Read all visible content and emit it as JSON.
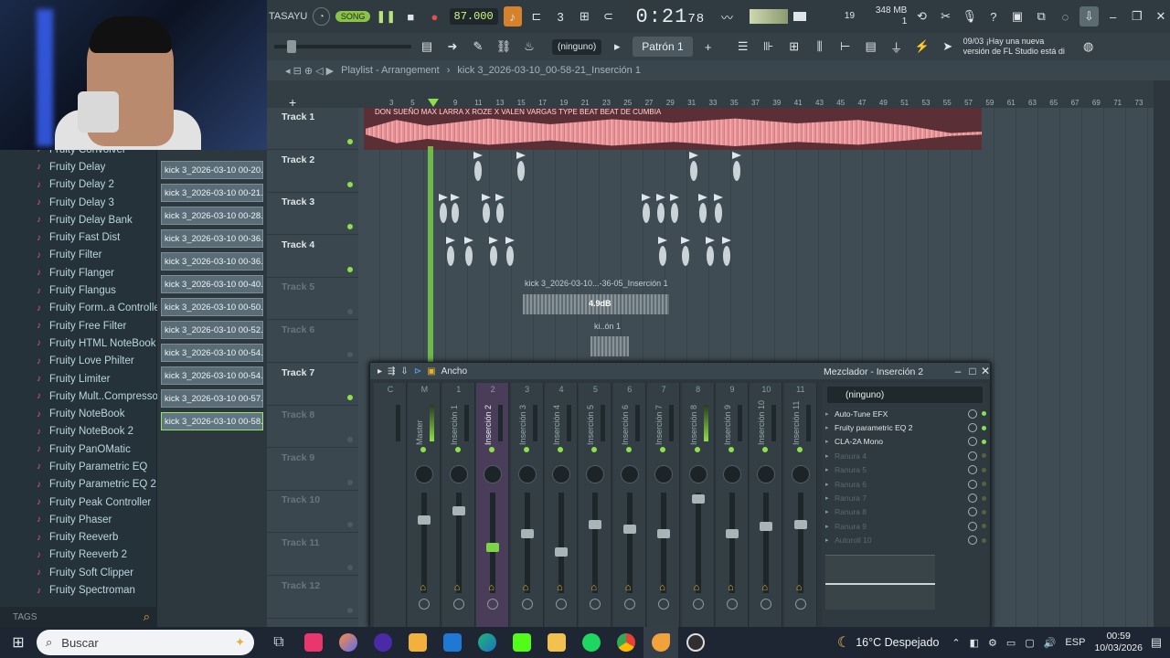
{
  "toolbar": {
    "mode_label": "TASAYU",
    "song_label": "SONG",
    "tempo": "87.000",
    "time_main": "0:21",
    "time_sub": "78",
    "cpu_label": "19",
    "memory": "348 MB",
    "voices": "1"
  },
  "toolbar2": {
    "channel_select": "(ninguno)",
    "pattern": "Patrón 1",
    "news_date": "09/03",
    "news_text": "¡Hay una nueva versión de FL Studio está di"
  },
  "browser": {
    "plugins": [
      "Fruity Convolver",
      "Fruity Delay",
      "Fruity Delay 2",
      "Fruity Delay 3",
      "Fruity Delay Bank",
      "Fruity Fast Dist",
      "Fruity Filter",
      "Fruity Flanger",
      "Fruity Flangus",
      "Fruity Form..a Controller",
      "Fruity Free Filter",
      "Fruity HTML NoteBook",
      "Fruity Love Philter",
      "Fruity Limiter",
      "Fruity Mult..Compressor",
      "Fruity NoteBook",
      "Fruity NoteBook 2",
      "Fruity PanOMatic",
      "Fruity Parametric EQ",
      "Fruity Parametric EQ 2",
      "Fruity Peak Controller",
      "Fruity Phaser",
      "Fruity Reeverb",
      "Fruity Reeverb 2",
      "Fruity Soft Clipper",
      "Fruity Spectroman"
    ],
    "tags_label": "TAGS"
  },
  "clips": [
    "kick 3_2026-03-10 00-20..",
    "kick 3_2026-03-10 00-21..",
    "kick 3_2026-03-10 00-28..",
    "kick 3_2026-03-10 00-36..",
    "kick 3_2026-03-10 00-36..",
    "kick 3_2026-03-10 00-40..",
    "kick 3_2026-03-10 00-50..",
    "kick 3_2026-03-10 00-52..",
    "kick 3_2026-03-10 00-54..",
    "kick 3_2026-03-10 00-54..",
    "kick 3_2026-03-10 00-57..",
    "kick 3_2026-03-10 00-58.."
  ],
  "playlist": {
    "title": "Playlist - Arrangement",
    "file": "kick 3_2026-03-10_00-58-21_Inserción 1",
    "ruler": [
      "3",
      "5",
      "7",
      "9",
      "11",
      "13",
      "15",
      "17",
      "19",
      "21",
      "23",
      "25",
      "27",
      "29",
      "31",
      "33",
      "35",
      "37",
      "39",
      "41",
      "43",
      "45",
      "47",
      "49",
      "51",
      "53",
      "55",
      "57",
      "59",
      "61",
      "63",
      "65",
      "67",
      "69",
      "71",
      "73"
    ],
    "tracks": [
      "Track 1",
      "Track 2",
      "Track 3",
      "Track 4",
      "Track 5",
      "Track 6",
      "Track 7",
      "Track 8",
      "Track 9",
      "Track 10",
      "Track 11",
      "Track 12"
    ],
    "audio_title": "DON SUEÑO MAX LARRA X ROZE X VALEN VARGAS TYPE BEAT BEAT DE CUMBIA",
    "ghost_clip": "kick 3_2026-03-10...-36-05_Inserción 1",
    "ghost_db": "4.9dB",
    "ghost_clip2": "ki..ón 1"
  },
  "mixer": {
    "width_label": "Ancho",
    "title": "Mezclador - Inserción 2",
    "strip_nums": [
      "C",
      "M",
      "1",
      "2",
      "3",
      "4",
      "5",
      "6",
      "7",
      "8",
      "9",
      "10",
      "11"
    ],
    "strip_names": [
      "",
      "Master",
      "Inserción 1",
      "Inserción 2",
      "Inserción 3",
      "Inserción 4",
      "Inserción 5",
      "Inserción 6",
      "Inserción 7",
      "Inserción 8",
      "Inserción 9",
      "Inserción 10",
      "Inserción 11"
    ],
    "fx_select": "(ninguno)",
    "slots": [
      "Auto-Tune EFX",
      "Fruity parametric EQ 2",
      "CLA-2A Mono",
      "Ranura 4",
      "Ranura 5",
      "Ranura 6",
      "Ranura 7",
      "Ranura 8",
      "Ranura 9",
      "Autoroll 10"
    ]
  },
  "taskbar": {
    "search_placeholder": "Buscar",
    "weather": "16°C Despejado",
    "lang": "ESP",
    "time": "00:59",
    "date": "10/03/2026"
  }
}
